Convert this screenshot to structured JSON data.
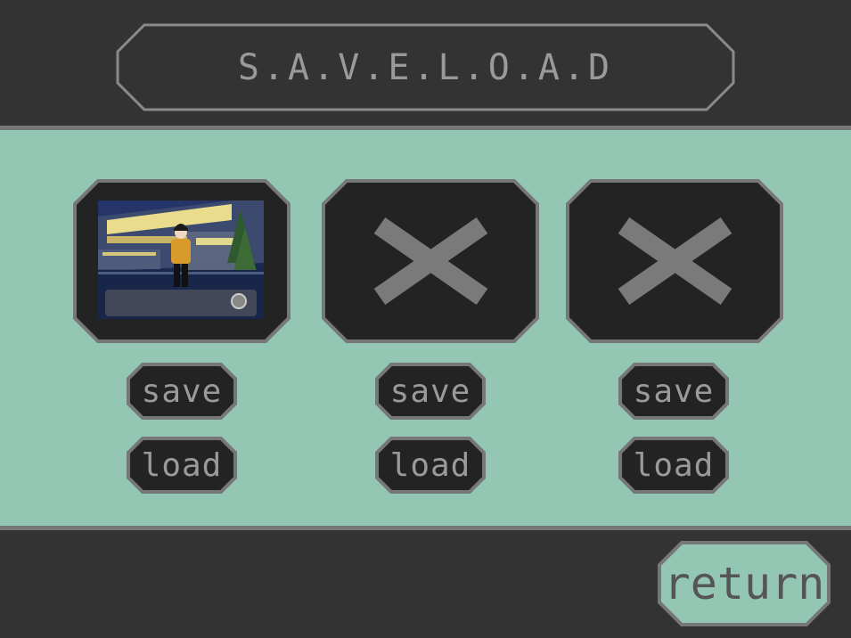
{
  "title": "S.A.V.E.L.O.A.D",
  "slots": [
    {
      "state": "filled",
      "save_label": "save",
      "load_label": "load"
    },
    {
      "state": "empty",
      "icon": "x-icon",
      "save_label": "save",
      "load_label": "load"
    },
    {
      "state": "empty",
      "icon": "x-icon",
      "save_label": "save",
      "load_label": "load"
    }
  ],
  "return_label": "return",
  "colors": {
    "background": "#333333",
    "band": "#93c6b3",
    "panel": "#232323",
    "border": "#777777",
    "text": "#9a9a9a",
    "return_fill": "#93c6b3"
  }
}
